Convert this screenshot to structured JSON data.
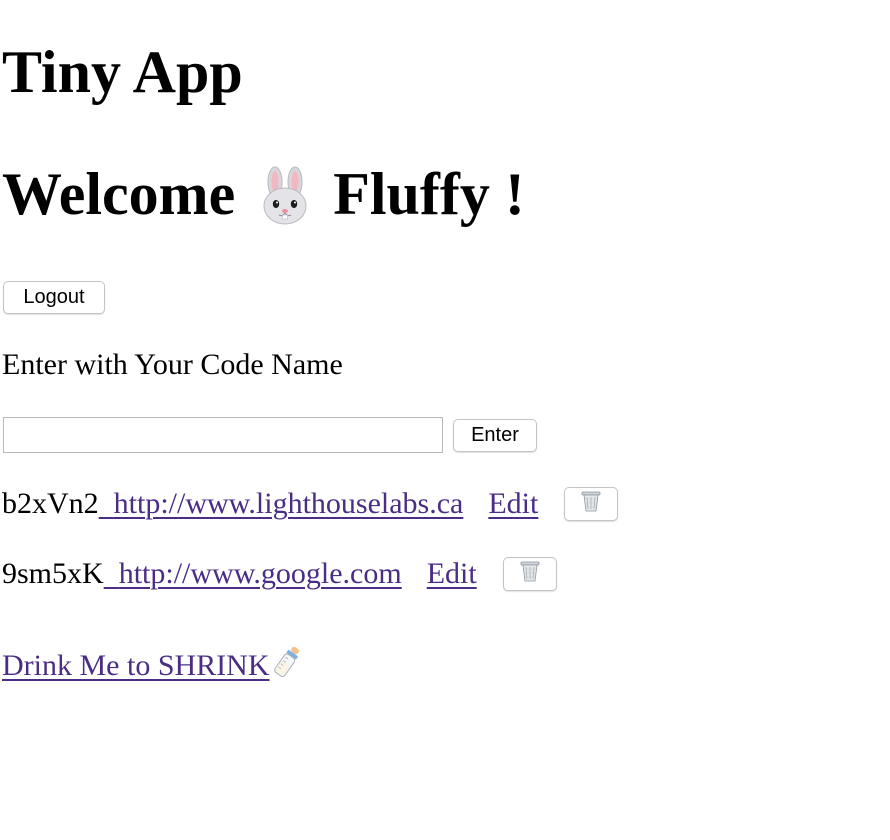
{
  "app_title": "Tiny App",
  "welcome": {
    "prefix": "Welcome",
    "emoji": "rabbit-face-icon",
    "name": "Fluffy !"
  },
  "logout_label": "Logout",
  "prompt_text": "Enter with Your Code Name",
  "code_input": {
    "value": "",
    "placeholder": ""
  },
  "enter_label": "Enter",
  "urls": [
    {
      "short": "b2xVn2",
      "long": "http://www.lighthouselabs.ca",
      "edit_label": "Edit",
      "delete_icon": "trash-can-icon"
    },
    {
      "short": "9sm5xK",
      "long": "http://www.google.com",
      "edit_label": "Edit",
      "delete_icon": "trash-can-icon"
    }
  ],
  "shrink_link": {
    "text": "Drink Me to SHRINK",
    "icon": "baby-bottle-icon"
  },
  "colors": {
    "link": "#4a2d85",
    "text": "#000000",
    "background": "#ffffff"
  }
}
